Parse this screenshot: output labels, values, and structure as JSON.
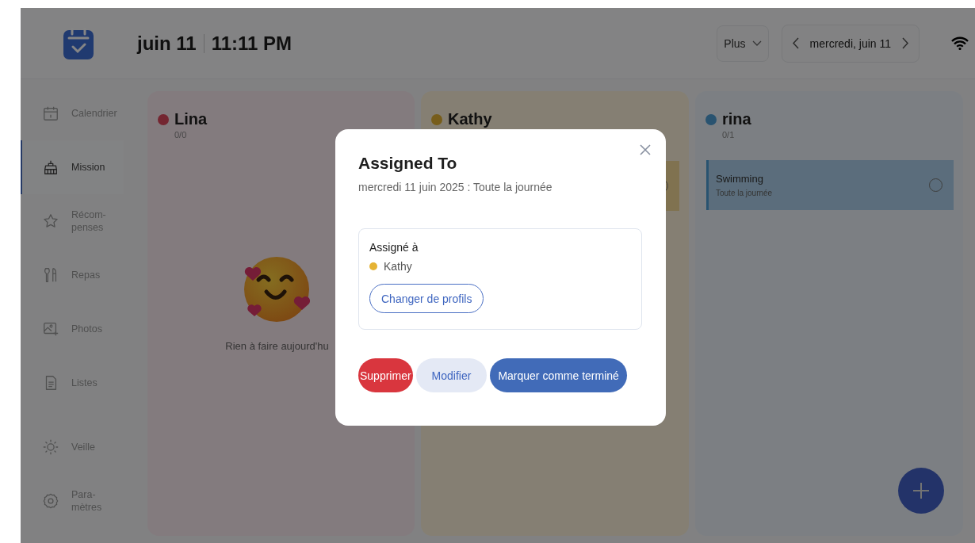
{
  "header": {
    "date": "juin 11",
    "time": "11:11 PM",
    "more_button": "Plus",
    "date_label": "mercredi, juin 11"
  },
  "sidebar": {
    "items": [
      {
        "label": "Calendrier",
        "selected": false
      },
      {
        "label": "Mission",
        "selected": true
      },
      {
        "label": "Récom-\npenses",
        "selected": false
      },
      {
        "label": "Repas",
        "selected": false
      },
      {
        "label": "Photos",
        "selected": false
      },
      {
        "label": "Listes",
        "selected": false
      }
    ],
    "bottom_items": [
      {
        "label": "Veille",
        "selected": false
      },
      {
        "label": "Para-\nmètres",
        "selected": false
      }
    ]
  },
  "columns": [
    {
      "name": "Lina",
      "color": "#742631",
      "count": "0/0",
      "empty_message": "Rien à faire aujourd'hu"
    },
    {
      "name": "Kathy",
      "color": "#775d1b",
      "tasks": [
        {
          "done": false
        }
      ]
    },
    {
      "name": "rina",
      "color": "#295370",
      "count": "0/1",
      "tasks": [
        {
          "title": "Swimming",
          "time": "Toute la journée",
          "done": false
        }
      ]
    }
  ],
  "dialog": {
    "title": "Assigned To",
    "subtitle": "mercredi 11 juin 2025 : Toute la journée",
    "assigned_label": "Assigné à",
    "assignee": {
      "name": "Kathy",
      "color": "#e5b334"
    },
    "change_button": "Changer de profils",
    "buttons": [
      {
        "label": "Supprimer",
        "kind": "danger"
      },
      {
        "label": "Modifier",
        "kind": "secondary"
      },
      {
        "label": "Marquer comme terminé",
        "kind": "primary"
      }
    ]
  }
}
